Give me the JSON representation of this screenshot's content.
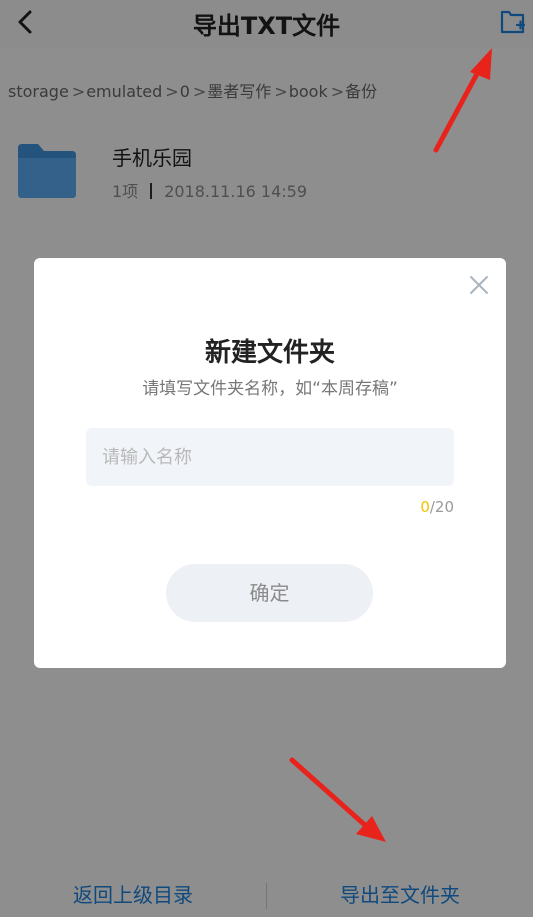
{
  "header": {
    "title": "导出TXT文件"
  },
  "breadcrumb": {
    "items": [
      "storage",
      "emulated",
      "0",
      "墨者写作",
      "book",
      "备份"
    ],
    "separator": ">"
  },
  "folder": {
    "name": "手机乐园",
    "count": "1项",
    "date": "2018.11.16 14:59"
  },
  "dialog": {
    "title": "新建文件夹",
    "subtitle": "请填写文件夹名称，如“本周存稿”",
    "input_placeholder": "请输入名称",
    "count_current": "0",
    "count_max": "/20",
    "confirm_label": "确定"
  },
  "bottom": {
    "left_label": "返回上级目录",
    "right_label": "导出至文件夹"
  },
  "colors": {
    "accent_blue": "#1a7fd9",
    "counter_yellow": "#f2c200",
    "arrow_red": "#e8231b"
  },
  "icons": [
    "back-icon",
    "new-folder-icon",
    "folder-icon",
    "close-icon"
  ]
}
